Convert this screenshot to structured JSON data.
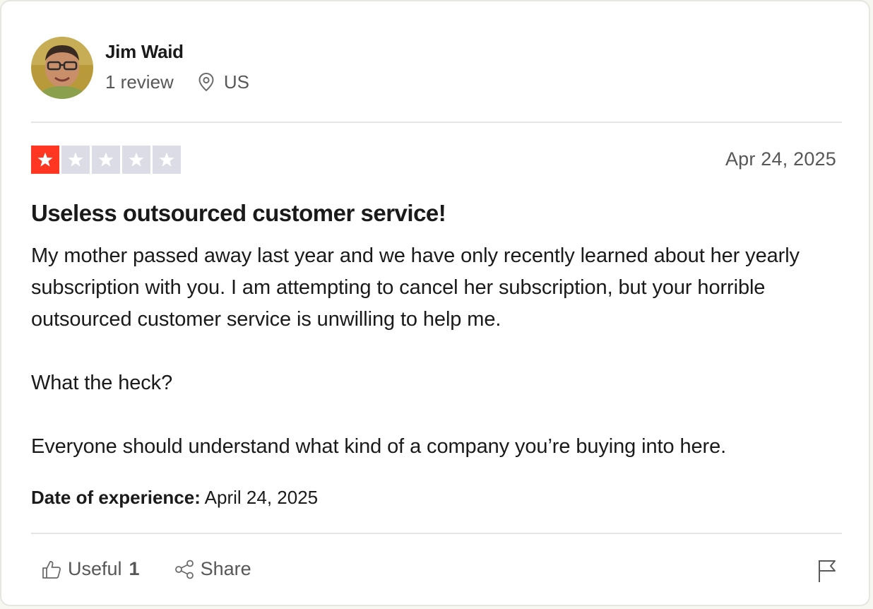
{
  "reviewer": {
    "name": "Jim Waid",
    "review_count": "1 review",
    "country": "US",
    "location_icon": "map-pin-icon",
    "avatar": "profile-photo"
  },
  "review": {
    "rating": 1,
    "max_rating": 5,
    "rating_color": "#ff3722",
    "empty_star_color": "#dcdce6",
    "date": "Apr 24, 2025",
    "title": "Useless outsourced customer service!",
    "body": [
      "My mother passed away last year and we have only recently learned about her yearly subscription with you. I am attempting to cancel her subscription, but your horrible outsourced customer service is unwilling to help me.",
      "What the heck?",
      "Everyone should understand what kind of a company you’re buying into here."
    ],
    "experience_label": "Date of experience:",
    "experience_date": "April 24, 2025"
  },
  "actions": {
    "useful_label": "Useful",
    "useful_count": "1",
    "useful_icon": "thumbs-up-icon",
    "share_label": "Share",
    "share_icon": "share-icon",
    "report_icon": "flag-icon"
  }
}
